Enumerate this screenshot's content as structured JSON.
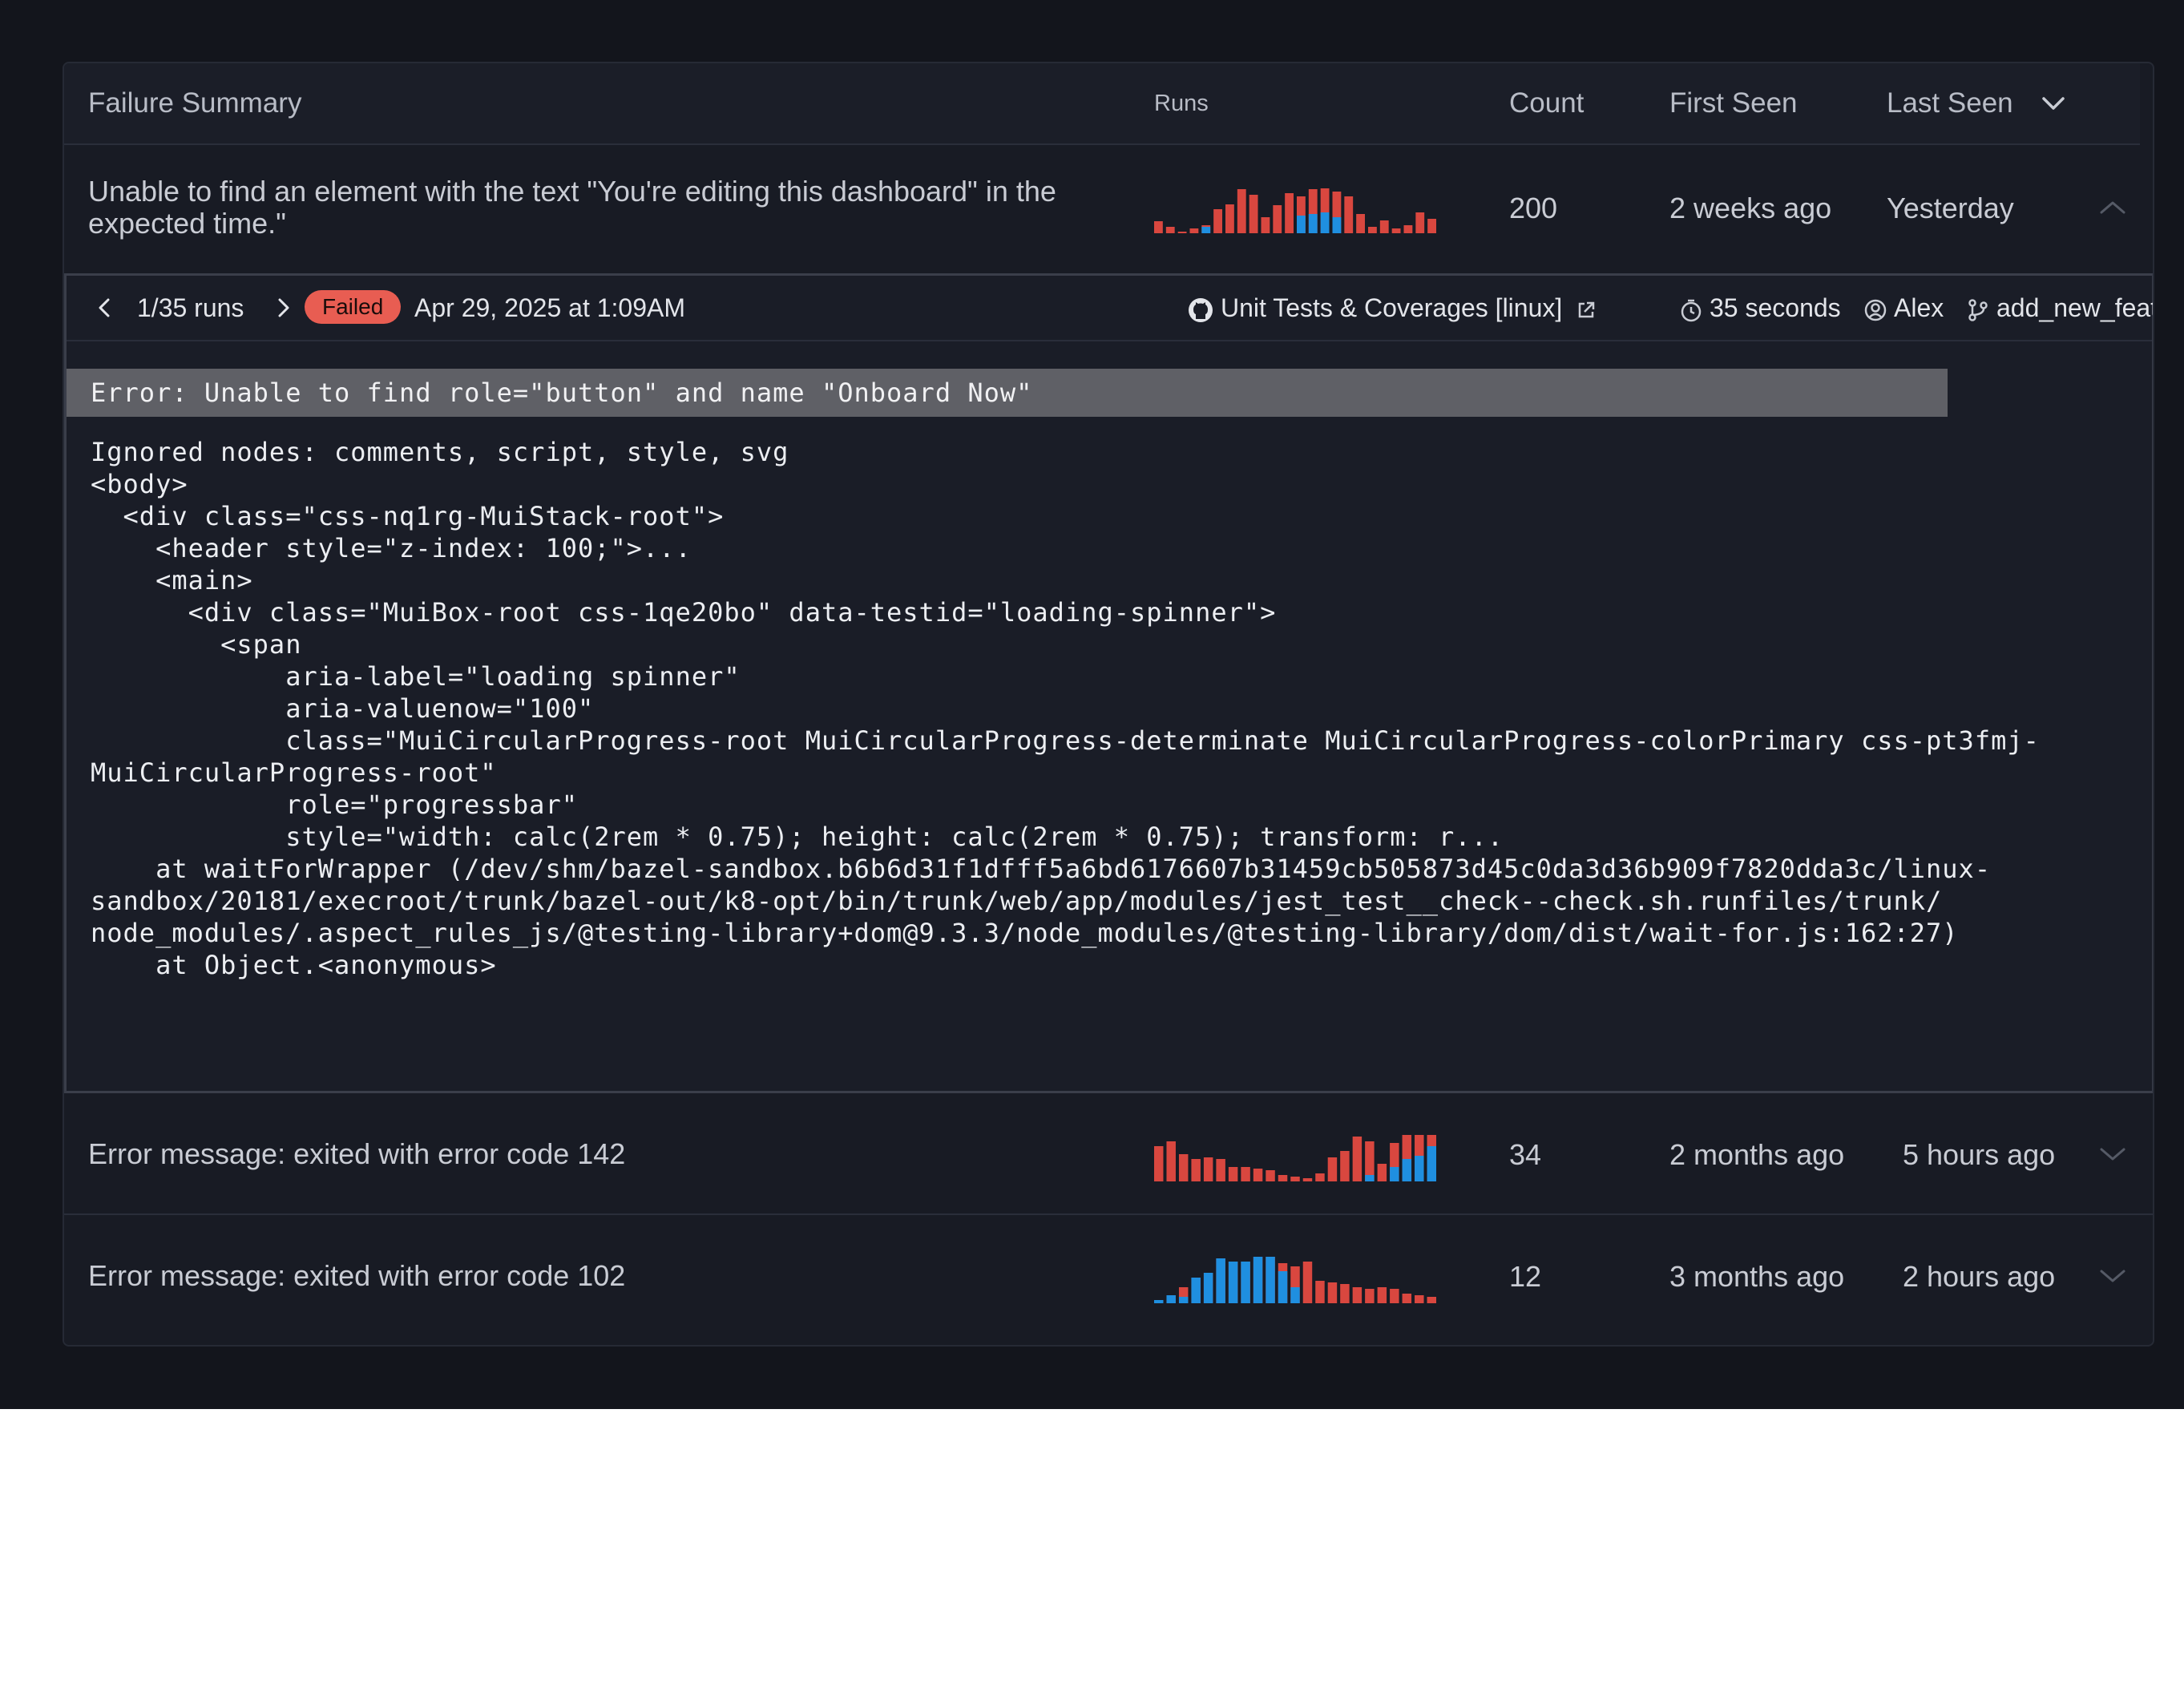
{
  "colors": {
    "fail": "#d9473f",
    "flaky": "#1f8fe0",
    "badge": "#e85d52"
  },
  "header": {
    "failure_summary": "Failure Summary",
    "runs": "Runs",
    "count": "Count",
    "first_seen": "First Seen",
    "last_seen": "Last Seen"
  },
  "rows": [
    {
      "summary": "Unable to find an element with the text \"You're editing this dashboard\" in the expected time.\"",
      "count": "200",
      "first_seen": "2 weeks ago",
      "last_seen": "Yesterday",
      "runs_chart": [
        [
          15,
          0
        ],
        [
          8,
          0
        ],
        [
          2,
          0
        ],
        [
          6,
          0
        ],
        [
          10,
          8
        ],
        [
          30,
          0
        ],
        [
          36,
          0
        ],
        [
          55,
          0
        ],
        [
          48,
          0
        ],
        [
          20,
          0
        ],
        [
          35,
          0
        ],
        [
          50,
          0
        ],
        [
          46,
          22
        ],
        [
          55,
          24
        ],
        [
          56,
          26
        ],
        [
          52,
          20
        ],
        [
          46,
          0
        ],
        [
          24,
          0
        ],
        [
          8,
          0
        ],
        [
          16,
          0
        ],
        [
          6,
          0
        ],
        [
          10,
          0
        ],
        [
          26,
          0
        ],
        [
          18,
          0
        ]
      ]
    },
    {
      "summary": "Error message: exited with error code 142",
      "count": "34",
      "first_seen": "2 months ago",
      "last_seen": "5 hours ago",
      "runs_chart": [
        [
          44,
          0
        ],
        [
          50,
          0
        ],
        [
          34,
          0
        ],
        [
          28,
          0
        ],
        [
          30,
          0
        ],
        [
          28,
          0
        ],
        [
          18,
          0
        ],
        [
          18,
          0
        ],
        [
          16,
          0
        ],
        [
          14,
          0
        ],
        [
          8,
          0
        ],
        [
          6,
          0
        ],
        [
          4,
          0
        ],
        [
          10,
          0
        ],
        [
          30,
          0
        ],
        [
          38,
          0
        ],
        [
          56,
          0
        ],
        [
          50,
          8
        ],
        [
          22,
          0
        ],
        [
          48,
          18
        ],
        [
          58,
          28
        ],
        [
          58,
          32
        ],
        [
          58,
          44
        ]
      ]
    },
    {
      "summary": "Error message: exited with error code 102",
      "count": "12",
      "first_seen": "3 months ago",
      "last_seen": "2 hours ago",
      "runs_chart": [
        [
          4,
          4
        ],
        [
          10,
          10
        ],
        [
          20,
          8
        ],
        [
          32,
          32
        ],
        [
          38,
          38
        ],
        [
          56,
          56
        ],
        [
          52,
          52
        ],
        [
          52,
          52
        ],
        [
          58,
          58
        ],
        [
          58,
          58
        ],
        [
          50,
          40
        ],
        [
          46,
          20
        ],
        [
          52,
          0
        ],
        [
          28,
          0
        ],
        [
          26,
          0
        ],
        [
          24,
          0
        ],
        [
          20,
          0
        ],
        [
          18,
          0
        ],
        [
          20,
          0
        ],
        [
          18,
          0
        ],
        [
          12,
          0
        ],
        [
          10,
          0
        ],
        [
          8,
          0
        ]
      ]
    }
  ],
  "detail": {
    "runs_label": "1/35 runs",
    "status": "Failed",
    "timestamp": "Apr 29, 2025 at 1:09AM",
    "job": "Unit Tests & Coverages [linux]",
    "duration": "35 seconds",
    "author": "Alex",
    "branch": "add_new_feature",
    "error_line": "Error: Unable to find role=\"button\" and name \"Onboard Now\"",
    "trace": "Ignored nodes: comments, script, style, svg\n<body>\n  <div class=\"css-nq1rg-MuiStack-root\">\n    <header style=\"z-index: 100;\">...\n    <main>\n      <div class=\"MuiBox-root css-1qe20bo\" data-testid=\"loading-spinner\">\n        <span\n            aria-label=\"loading spinner\"\n            aria-valuenow=\"100\"\n            class=\"MuiCircularProgress-root MuiCircularProgress-determinate MuiCircularProgress-colorPrimary css-pt3fmj-\nMuiCircularProgress-root\"\n            role=\"progressbar\"\n            style=\"width: calc(2rem * 0.75); height: calc(2rem * 0.75); transform: r...\n    at waitForWrapper (/dev/shm/bazel-sandbox.b6b6d31f1dfff5a6bd6176607b31459cb505873d45c0da3d36b909f7820dda3c/linux-\nsandbox/20181/execroot/trunk/bazel-out/k8-opt/bin/trunk/web/app/modules/jest_test__check--check.sh.runfiles/trunk/\nnode_modules/.aspect_rules_js/@testing-library+dom@9.3.3/node_modules/@testing-library/dom/dist/wait-for.js:162:27)\n    at Object.<anonymous>"
  }
}
